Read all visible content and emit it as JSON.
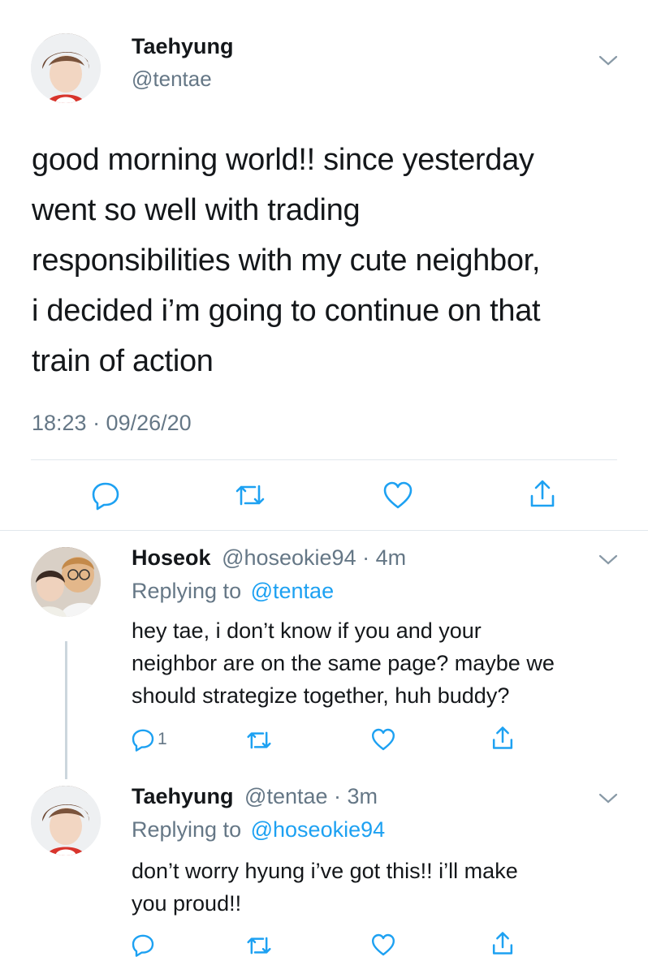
{
  "main_tweet": {
    "name": "Taehyung",
    "handle": "@tentae",
    "text_lines": [
      "good morning world!! since yesterday",
      "went so well with trading",
      "responsibilities with my cute neighbor,",
      "i decided i’m going to continue on that",
      "train of action"
    ],
    "timestamp": "18:23 · 09/26/20"
  },
  "replies": [
    {
      "name": "Hoseok",
      "handle_time": "@hoseokie94 · 4m",
      "replying_prefix": "Replying to",
      "replying_handle": "@tentae",
      "text_lines": [
        "hey tae, i don’t know if you and your",
        "neighbor are on the same page? maybe we",
        "should strategize together, huh buddy?"
      ],
      "reply_count": "1"
    },
    {
      "name": "Taehyung",
      "handle_time": "@tentae · 3m",
      "replying_prefix": "Replying to",
      "replying_handle": "@hoseokie94",
      "text_lines": [
        "don’t worry hyung i’ve got this!! i’ll make",
        "you proud!!"
      ],
      "reply_count": ""
    }
  ],
  "icons": [
    "reply-icon",
    "retweet-icon",
    "like-icon",
    "share-icon",
    "chevron-down-icon"
  ],
  "colors": {
    "link": "#1da1f2",
    "muted": "#657786",
    "divider": "#e1e8ed"
  }
}
